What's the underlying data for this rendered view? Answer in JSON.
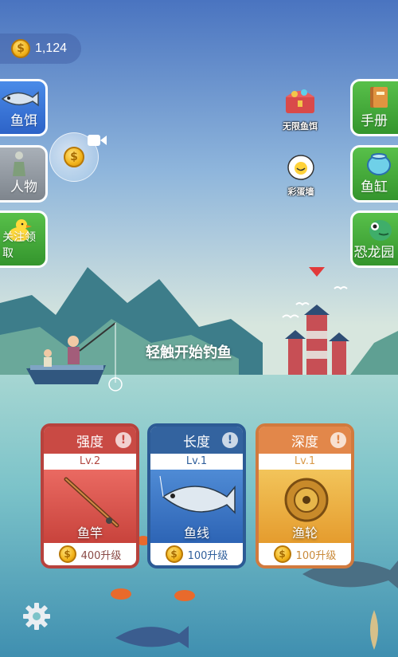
{
  "hud": {
    "coins": "1,124"
  },
  "left_buttons": [
    {
      "label": "鱼饵",
      "icon": "tuna-icon"
    },
    {
      "label": "人物",
      "icon": "figure-icon"
    },
    {
      "label": "关注领取",
      "icon": "duck-icon"
    }
  ],
  "right_buttons": [
    {
      "label": "手册",
      "icon": "book-icon"
    },
    {
      "label": "鱼缸",
      "icon": "fishbowl-icon"
    },
    {
      "label": "恐龙园",
      "icon": "dinosaur-icon"
    }
  ],
  "floating": {
    "unlimited_bait": "无限鱼饵",
    "easter_egg_wall": "彩蛋墙"
  },
  "hint": "轻触开始钓鱼",
  "cards": [
    {
      "title": "强度",
      "level": "Lv.2",
      "item": "鱼竿",
      "cost": "400升级",
      "color": "#c94a44"
    },
    {
      "title": "长度",
      "level": "Lv.1",
      "item": "鱼线",
      "cost": "100升级",
      "color": "#33639f"
    },
    {
      "title": "深度",
      "level": "Lv.1",
      "item": "渔轮",
      "cost": "100升级",
      "color": "#e2874a"
    }
  ],
  "coin_symbol": "$"
}
